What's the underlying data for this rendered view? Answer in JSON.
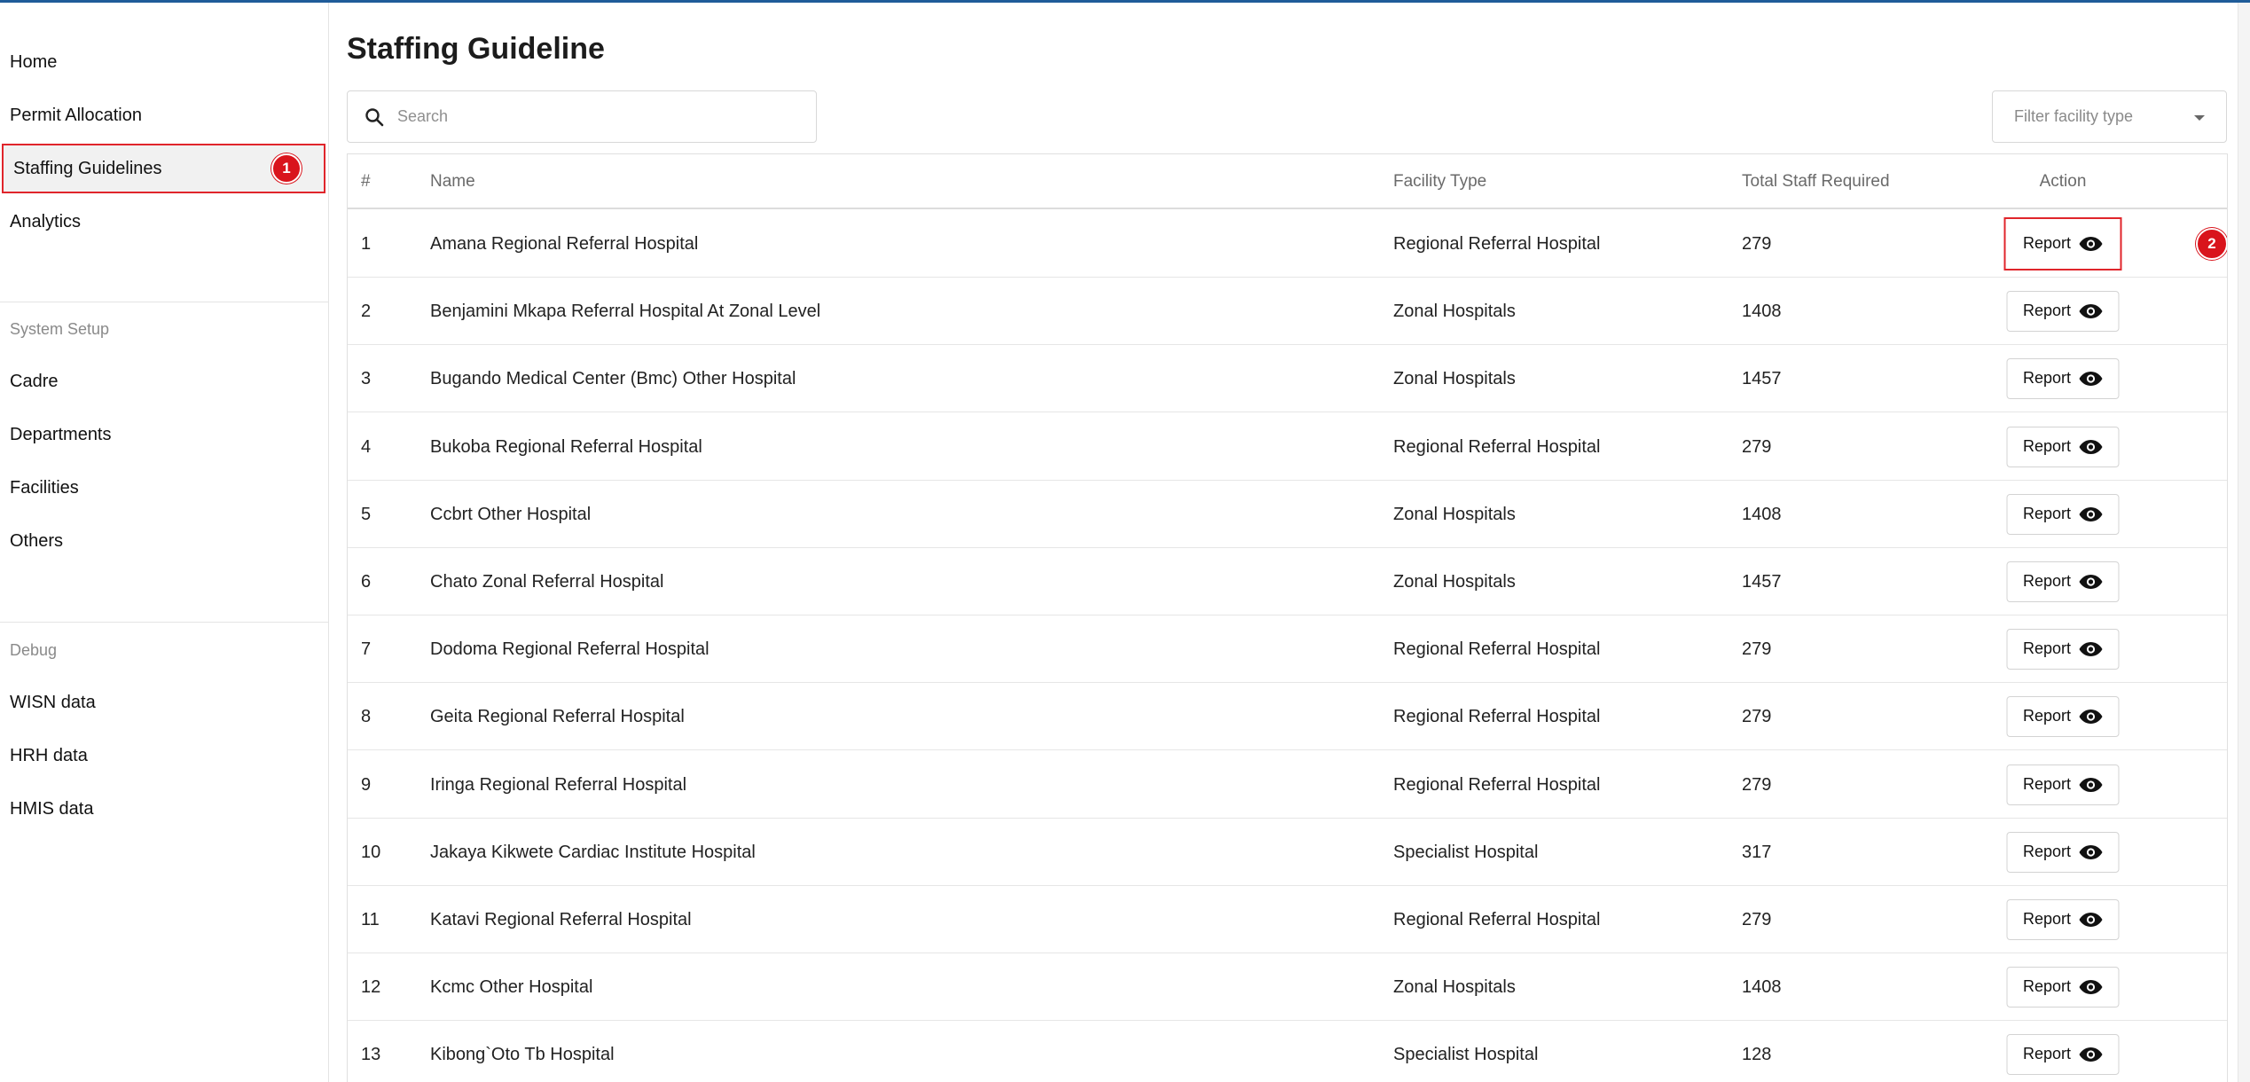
{
  "colors": {
    "accent": "#1f5c99",
    "highlight": "#e0252b",
    "badge": "#d9141c"
  },
  "sidebar": {
    "items": [
      {
        "label": "Home"
      },
      {
        "label": "Permit Allocation"
      },
      {
        "label": "Staffing Guidelines",
        "active": true,
        "badge": "1"
      },
      {
        "label": "Analytics"
      }
    ],
    "system_setup": {
      "title": "System Setup",
      "items": [
        {
          "label": "Cadre"
        },
        {
          "label": "Departments"
        },
        {
          "label": "Facilities"
        },
        {
          "label": "Others"
        }
      ]
    },
    "debug": {
      "title": "Debug",
      "items": [
        {
          "label": "WISN data"
        },
        {
          "label": "HRH data"
        },
        {
          "label": "HMIS data"
        }
      ]
    }
  },
  "main": {
    "title": "Staffing Guideline",
    "search": {
      "placeholder": "Search",
      "value": "",
      "icon": "search-icon"
    },
    "filter": {
      "placeholder": "Filter facility type",
      "icon": "chevron-down-icon"
    },
    "table": {
      "columns": [
        "#",
        "Name",
        "Facility Type",
        "Total Staff Required",
        "Action"
      ],
      "action_label": "Report",
      "action_icon": "eye-icon",
      "highlight_badge": "2",
      "rows": [
        {
          "num": "1",
          "name": "Amana Regional Referral Hospital",
          "type": "Regional Referral Hospital",
          "total": "279"
        },
        {
          "num": "2",
          "name": "Benjamini Mkapa Referral Hospital At Zonal Level",
          "type": "Zonal Hospitals",
          "total": "1408"
        },
        {
          "num": "3",
          "name": "Bugando Medical Center (Bmc) Other Hospital",
          "type": "Zonal Hospitals",
          "total": "1457"
        },
        {
          "num": "4",
          "name": "Bukoba Regional Referral Hospital",
          "type": "Regional Referral Hospital",
          "total": "279"
        },
        {
          "num": "5",
          "name": "Ccbrt Other Hospital",
          "type": "Zonal Hospitals",
          "total": "1408"
        },
        {
          "num": "6",
          "name": "Chato Zonal Referral Hospital",
          "type": "Zonal Hospitals",
          "total": "1457"
        },
        {
          "num": "7",
          "name": "Dodoma Regional Referral Hospital",
          "type": "Regional Referral Hospital",
          "total": "279"
        },
        {
          "num": "8",
          "name": "Geita Regional Referral Hospital",
          "type": "Regional Referral Hospital",
          "total": "279"
        },
        {
          "num": "9",
          "name": "Iringa Regional Referral Hospital",
          "type": "Regional Referral Hospital",
          "total": "279"
        },
        {
          "num": "10",
          "name": "Jakaya Kikwete Cardiac Institute Hospital",
          "type": "Specialist Hospital",
          "total": "317"
        },
        {
          "num": "11",
          "name": "Katavi Regional Referral Hospital",
          "type": "Regional Referral Hospital",
          "total": "279"
        },
        {
          "num": "12",
          "name": "Kcmc Other Hospital",
          "type": "Zonal Hospitals",
          "total": "1408"
        },
        {
          "num": "13",
          "name": "Kibong`Oto Tb Hospital",
          "type": "Specialist Hospital",
          "total": "128"
        }
      ]
    }
  }
}
